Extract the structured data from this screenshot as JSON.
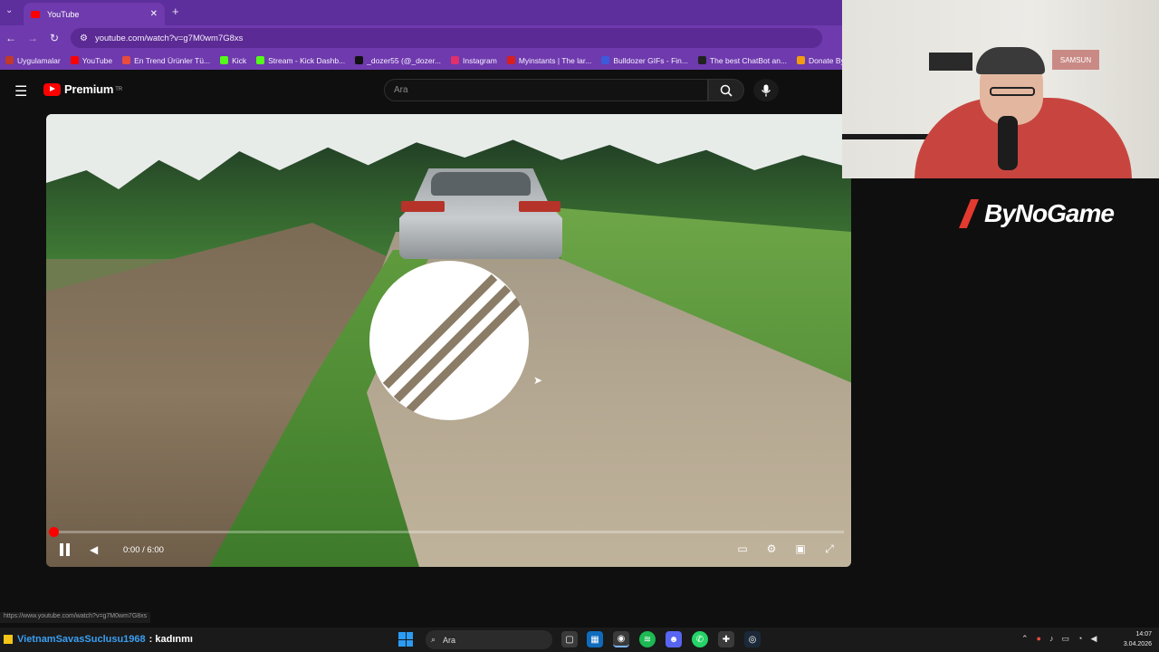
{
  "browser": {
    "tab_title": "YouTube",
    "url": "youtube.com/watch?v=g7M0wm7G8xs",
    "bookmarks": [
      {
        "label": "Uygulamalar",
        "color": "#c0392b"
      },
      {
        "label": "YouTube",
        "color": "#ff0000"
      },
      {
        "label": "En Trend Ürünler Tü...",
        "color": "#e74c3c"
      },
      {
        "label": "Kick",
        "color": "#53fc18"
      },
      {
        "label": "Stream - Kick Dashb...",
        "color": "#53fc18"
      },
      {
        "label": "_dozer55 (@_dozer...",
        "color": "#111111"
      },
      {
        "label": "Instagram",
        "color": "#e1306c"
      },
      {
        "label": "Myinstants | The lar...",
        "color": "#d81e1e"
      },
      {
        "label": "Bulldozer GIFs - Fin...",
        "color": "#3b5bdb"
      },
      {
        "label": "The best ChatBot an...",
        "color": "#222222"
      },
      {
        "label": "Donate ByNoGam",
        "color": "#f39c12"
      }
    ],
    "status_url": "https://www.youtube.com/watch?v=g7M0wm7G8xs"
  },
  "youtube": {
    "logo_text": "Premium",
    "region": "TR",
    "search_placeholder": "Ara"
  },
  "player": {
    "time": "0:00 / 6:00",
    "progress": 0.0,
    "state": "paused-loading"
  },
  "overlay": {
    "brand": "ByNoGame",
    "samsung": "SAMSUN"
  },
  "taskbar": {
    "chat_user": "VietnamSavasSuclusu1968",
    "chat_message": ": kadınmı",
    "search_label": "Ara",
    "time": "14:07",
    "date": "3.04.2026"
  }
}
